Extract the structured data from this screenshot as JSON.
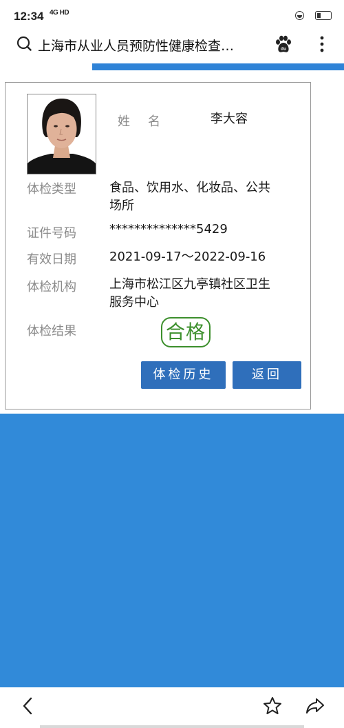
{
  "status_bar": {
    "time": "12:34",
    "network": "4G HD"
  },
  "browser": {
    "title": "上海市从业人员预防性健康检查…"
  },
  "record": {
    "name_label": "姓名",
    "name_value": "李大容",
    "exam_type_label": "体检类型",
    "exam_type_value_line1": "食品、饮用水、化妆品、公共",
    "exam_type_value_line2": "场所",
    "id_label": "证件号码",
    "id_value": "**************5429",
    "validity_label": "有效日期",
    "validity_value": "2021-09-17～2022-09-16",
    "org_label": "体检机构",
    "org_value_line1": "上海市松江区九亭镇社区卫生",
    "org_value_line2": "服务中心",
    "result_label": "体检结果",
    "result_value": "合格"
  },
  "actions": {
    "history_button": "体检历史",
    "back_button": "返回"
  },
  "colors": {
    "primary_blue": "#318ad9",
    "button_blue": "#2f6fbb",
    "pass_green": "#3c8f2c"
  },
  "icons": {
    "search": "search-icon",
    "baidu": "baidu-paw-icon",
    "more": "more-vertical-icon",
    "back": "chevron-left-icon",
    "favorite": "star-icon",
    "share": "share-icon"
  }
}
